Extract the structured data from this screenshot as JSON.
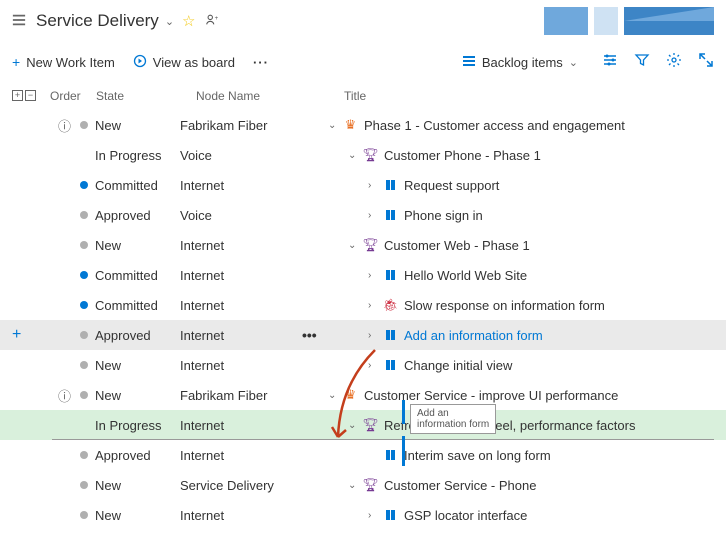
{
  "header": {
    "title": "Service Delivery"
  },
  "toolbar": {
    "new_item": "New Work Item",
    "view_board": "View as board",
    "backlog_items": "Backlog items"
  },
  "columns": {
    "order": "Order",
    "state": "State",
    "node": "Node Name",
    "title": "Title"
  },
  "states": {
    "new": "New",
    "in_progress": "In Progress",
    "committed": "Committed",
    "approved": "Approved"
  },
  "nodes": {
    "fabrikam": "Fabrikam Fiber",
    "voice": "Voice",
    "internet": "Internet",
    "service_delivery": "Service Delivery"
  },
  "rows": [
    {
      "state": "new",
      "node": "fabrikam",
      "indent": 0,
      "chev": "v",
      "type": "crown",
      "title": "Phase 1 - Customer access and engagement",
      "info": true
    },
    {
      "state": "in_progress",
      "node": "voice",
      "indent": 1,
      "chev": "v",
      "type": "trophy",
      "title": "Customer Phone - Phase 1"
    },
    {
      "state": "committed",
      "node": "internet",
      "indent": 2,
      "chev": ">",
      "type": "book",
      "title": "Request support"
    },
    {
      "state": "approved",
      "node": "voice",
      "indent": 2,
      "chev": ">",
      "type": "book",
      "title": "Phone sign in"
    },
    {
      "state": "new",
      "node": "internet",
      "indent": 1,
      "chev": "v",
      "type": "trophy",
      "title": "Customer Web - Phase 1"
    },
    {
      "state": "committed",
      "node": "internet",
      "indent": 2,
      "chev": ">",
      "type": "book",
      "title": "Hello World Web Site"
    },
    {
      "state": "committed",
      "node": "internet",
      "indent": 2,
      "chev": ">",
      "type": "bug",
      "title": "Slow response on information form"
    },
    {
      "state": "approved",
      "node": "internet",
      "indent": 2,
      "chev": ">",
      "type": "book",
      "title": "Add an information form",
      "selected": true,
      "link": true,
      "add": true,
      "actions": true
    },
    {
      "state": "new",
      "node": "internet",
      "indent": 2,
      "chev": ">",
      "type": "book",
      "title": "Change initial view"
    },
    {
      "state": "new",
      "node": "fabrikam",
      "indent": 0,
      "chev": "v",
      "type": "crown",
      "title": "Customer Service - improve UI performance",
      "info": true
    },
    {
      "state": "in_progress",
      "node": "internet",
      "indent": 1,
      "chev": "v",
      "type": "trophy",
      "title": "Refresh web look, feel, performance factors",
      "highlighted": true
    },
    {
      "state": "approved",
      "node": "internet",
      "indent": 2,
      "chev": "",
      "type": "book",
      "title": "Interim save on long form",
      "line": true
    },
    {
      "state": "new",
      "node": "service_delivery",
      "indent": 1,
      "chev": "v",
      "type": "trophy",
      "title": "Customer Service - Phone"
    },
    {
      "state": "new",
      "node": "internet",
      "indent": 2,
      "chev": ">",
      "type": "book",
      "title": "GSP locator interface"
    }
  ],
  "tooltip": "Add an\ninformation form",
  "actions_ellipsis": "•••"
}
